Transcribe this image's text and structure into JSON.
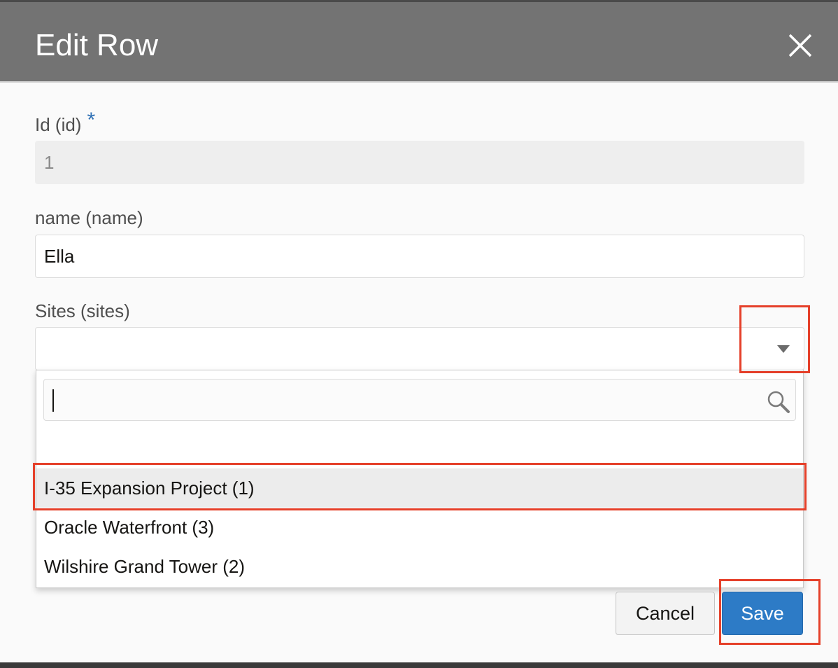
{
  "dialog": {
    "title": "Edit Row",
    "close_icon": "close-icon"
  },
  "form": {
    "id": {
      "label": "Id (id)",
      "required_marker": "*",
      "value": "1"
    },
    "name": {
      "label": "name (name)",
      "value": "Ella"
    },
    "sites": {
      "label": "Sites (sites)",
      "value": "",
      "arrow_icon": "chevron-down-icon",
      "dropdown": {
        "search_value": "",
        "search_icon": "search-icon",
        "options": [
          {
            "label": "I-35 Expansion Project (1)",
            "highlighted": true
          },
          {
            "label": "Oracle Waterfront (3)",
            "highlighted": false
          },
          {
            "label": "Wilshire Grand Tower (2)",
            "highlighted": false
          }
        ]
      }
    }
  },
  "buttons": {
    "cancel_label": "Cancel",
    "save_label": "Save"
  },
  "colors": {
    "title_bar": "#737373",
    "required": "#2d6fb4",
    "primary": "#2d7bc6",
    "highlight_box": "#e5402a"
  }
}
